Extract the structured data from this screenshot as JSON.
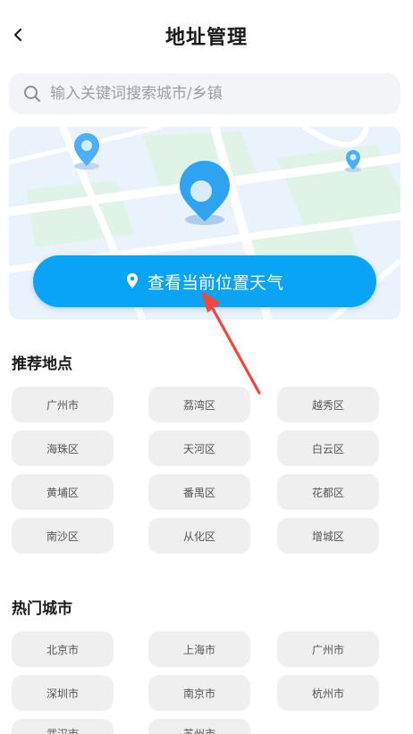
{
  "header": {
    "title": "地址管理",
    "back_icon": "chevron-left-icon"
  },
  "search": {
    "placeholder": "输入关键词搜索城市/乡镇",
    "icon": "search-icon"
  },
  "map": {
    "locate_label": "查看当前位置天气",
    "accent": "#0aa4f7"
  },
  "recommended": {
    "title": "推荐地点",
    "items": [
      "广州市",
      "荔湾区",
      "越秀区",
      "海珠区",
      "天河区",
      "白云区",
      "黄埔区",
      "番禺区",
      "花都区",
      "南沙区",
      "从化区",
      "增城区"
    ]
  },
  "hot_cities": {
    "title": "热门城市",
    "items": [
      "北京市",
      "上海市",
      "广州市",
      "深圳市",
      "南京市",
      "杭州市",
      "武汉市",
      "苏州市"
    ]
  }
}
